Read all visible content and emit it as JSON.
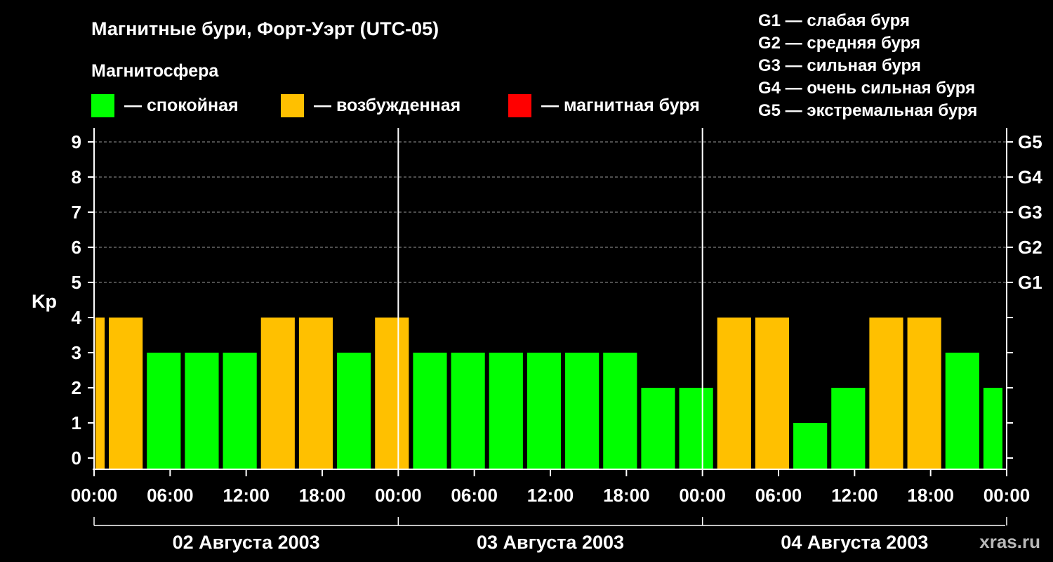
{
  "chart_data": {
    "type": "bar",
    "title": "Магнитные бури, Форт-Уэрт (UTC-05)",
    "legend_title": "Магнитосфера",
    "legend": [
      {
        "label": "— спокойная",
        "color": "#00ff00"
      },
      {
        "label": "— возбужденная",
        "color": "#ffc000"
      },
      {
        "label": "— магнитная буря",
        "color": "#ff0000"
      }
    ],
    "storm_scale": [
      "G1 — слабая буря",
      "G2 — средняя буря",
      "G3 — сильная буря",
      "G4 — очень сильная буря",
      "G5 — экстремальная буря"
    ],
    "ylabel": "Kp",
    "ylim": [
      0,
      9
    ],
    "y_ticks": [
      "0",
      "1",
      "2",
      "3",
      "4",
      "5",
      "6",
      "7",
      "8",
      "9"
    ],
    "g_ticks": [
      {
        "label": "G1",
        "value": 5
      },
      {
        "label": "G2",
        "value": 6
      },
      {
        "label": "G3",
        "value": 7
      },
      {
        "label": "G4",
        "value": 8
      },
      {
        "label": "G5",
        "value": 9
      }
    ],
    "x_ticks": [
      "00:00",
      "06:00",
      "12:00",
      "18:00",
      "00:00",
      "06:00",
      "12:00",
      "18:00",
      "00:00",
      "06:00",
      "12:00",
      "18:00",
      "00:00"
    ],
    "days": [
      "02 Августа 2003",
      "03 Августа 2003",
      "04 Августа 2003"
    ],
    "x_range_hours": [
      0,
      72
    ],
    "bars": [
      {
        "start": 0,
        "end": 1,
        "value": 4
      },
      {
        "start": 1,
        "end": 4,
        "value": 4
      },
      {
        "start": 4,
        "end": 7,
        "value": 3
      },
      {
        "start": 7,
        "end": 10,
        "value": 3
      },
      {
        "start": 10,
        "end": 13,
        "value": 3
      },
      {
        "start": 13,
        "end": 16,
        "value": 4
      },
      {
        "start": 16,
        "end": 19,
        "value": 4
      },
      {
        "start": 19,
        "end": 22,
        "value": 3
      },
      {
        "start": 22,
        "end": 25,
        "value": 4
      },
      {
        "start": 25,
        "end": 28,
        "value": 3
      },
      {
        "start": 28,
        "end": 31,
        "value": 3
      },
      {
        "start": 31,
        "end": 34,
        "value": 3
      },
      {
        "start": 34,
        "end": 37,
        "value": 3
      },
      {
        "start": 37,
        "end": 40,
        "value": 3
      },
      {
        "start": 40,
        "end": 43,
        "value": 3
      },
      {
        "start": 43,
        "end": 46,
        "value": 2
      },
      {
        "start": 46,
        "end": 49,
        "value": 2
      },
      {
        "start": 49,
        "end": 52,
        "value": 4
      },
      {
        "start": 52,
        "end": 55,
        "value": 4
      },
      {
        "start": 55,
        "end": 58,
        "value": 1
      },
      {
        "start": 58,
        "end": 61,
        "value": 2
      },
      {
        "start": 61,
        "end": 64,
        "value": 4
      },
      {
        "start": 64,
        "end": 67,
        "value": 4
      },
      {
        "start": 67,
        "end": 70,
        "value": 3
      },
      {
        "start": 70,
        "end": 72,
        "value": 2
      }
    ],
    "color_rule": {
      "quiet_max": 3,
      "active_max": 4
    },
    "colors": {
      "quiet": "#00ff00",
      "active": "#ffc000",
      "storm": "#ff0000"
    },
    "grid": true
  },
  "watermark": "xras.ru"
}
